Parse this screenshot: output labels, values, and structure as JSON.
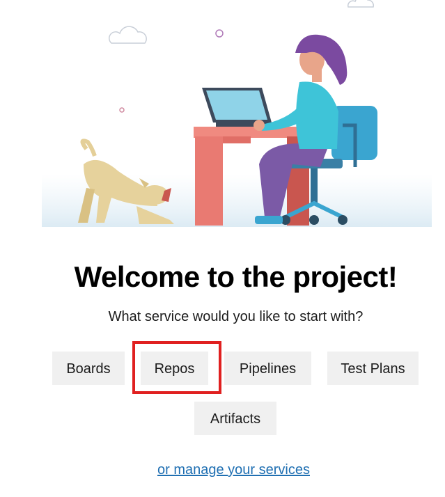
{
  "welcome": {
    "title": "Welcome to the project!",
    "subtitle": "What service would you like to start with?"
  },
  "services": [
    {
      "label": "Boards"
    },
    {
      "label": "Repos"
    },
    {
      "label": "Pipelines"
    },
    {
      "label": "Test Plans"
    },
    {
      "label": "Artifacts"
    }
  ],
  "manage_link": "or manage your services",
  "colors": {
    "button_bg": "#f0f0f0",
    "highlight": "#e02020",
    "link": "#1f6fb2"
  },
  "illustration_icons": [
    "cloud-icon",
    "woman-at-desk-illustration",
    "laptop-icon",
    "dog-illustration",
    "office-chair-icon"
  ]
}
